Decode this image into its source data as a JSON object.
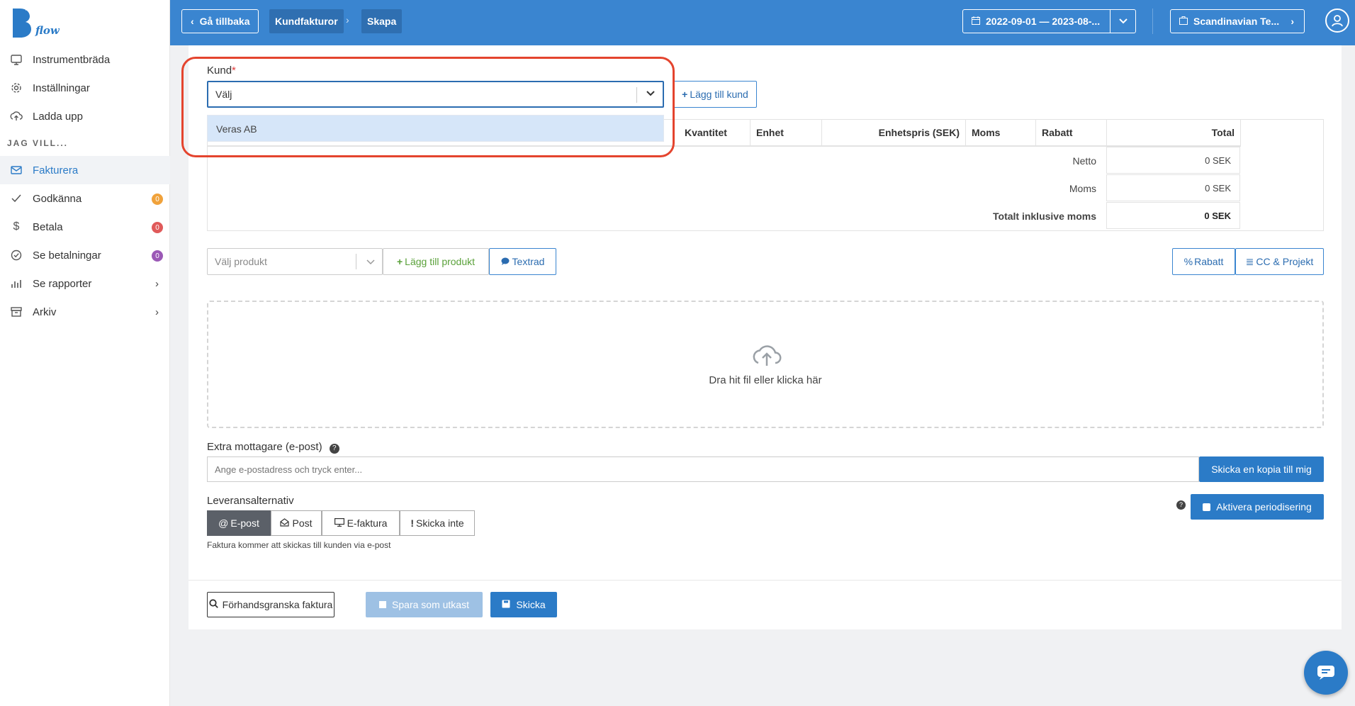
{
  "brand": {
    "name": "flow"
  },
  "sidebar": {
    "items": [
      {
        "label": "Instrumentbräda",
        "icon": "monitor-icon"
      },
      {
        "label": "Inställningar",
        "icon": "gear-icon"
      },
      {
        "label": "Ladda upp",
        "icon": "cloud-upload-icon"
      }
    ],
    "heading": "JAG VILL...",
    "actions": [
      {
        "label": "Fakturera",
        "icon": "envelope-icon",
        "active": true
      },
      {
        "label": "Godkänna",
        "icon": "check-icon",
        "badge": "0",
        "badge_color": "#f0a23b"
      },
      {
        "label": "Betala",
        "icon": "dollar-icon",
        "badge": "0",
        "badge_color": "#e05a5a"
      },
      {
        "label": "Se betalningar",
        "icon": "check-circle-icon",
        "badge": "0",
        "badge_color": "#9b59b6"
      },
      {
        "label": "Se rapporter",
        "icon": "bar-chart-icon",
        "has_arrow": true
      },
      {
        "label": "Arkiv",
        "icon": "archive-icon",
        "has_arrow": true
      }
    ]
  },
  "topbar": {
    "back_label": "Gå tillbaka",
    "breadcrumbs": [
      "Kundfakturor",
      "Skapa"
    ],
    "date_range": "2022-09-01 — 2023-08-...",
    "company": "Scandinavian Te...",
    "accent": "#3a85d0"
  },
  "form": {
    "customer_label": "Kund",
    "required_mark": "*",
    "customer_value": "Välj",
    "dropdown_option": "Veras AB",
    "add_customer": "Lägg till kund",
    "table_headers": [
      "Kvantitet",
      "Enhet",
      "Enhetspris (SEK)",
      "Moms",
      "Rabatt",
      "Total"
    ],
    "summary": [
      {
        "label": "Netto",
        "value": "0 SEK"
      },
      {
        "label": "Moms",
        "value": "0 SEK"
      },
      {
        "label": "Totalt inklusive moms",
        "value": "0 SEK"
      }
    ],
    "product_placeholder": "Välj produkt",
    "add_product": "Lägg till produkt",
    "text_row": "Textrad",
    "discount": "Rabatt",
    "cc_project": "CC & Projekt",
    "dropzone_text": "Dra hit fil eller klicka här",
    "extra_recipients_label": "Extra mottagare (e-post)",
    "email_placeholder": "Ange e-postadress och tryck enter...",
    "copy_to_me": "Skicka en kopia till mig",
    "delivery_label": "Leveransalternativ",
    "delivery_options": [
      "E-post",
      "Post",
      "E-faktura",
      "Skicka inte"
    ],
    "delivery_note": "Faktura kommer att skickas till kunden via e-post",
    "activate_periodization": "Aktivera periodisering",
    "preview": "Förhandsgranska faktura",
    "save_draft": "Spara som utkast",
    "send": "Skicka"
  }
}
